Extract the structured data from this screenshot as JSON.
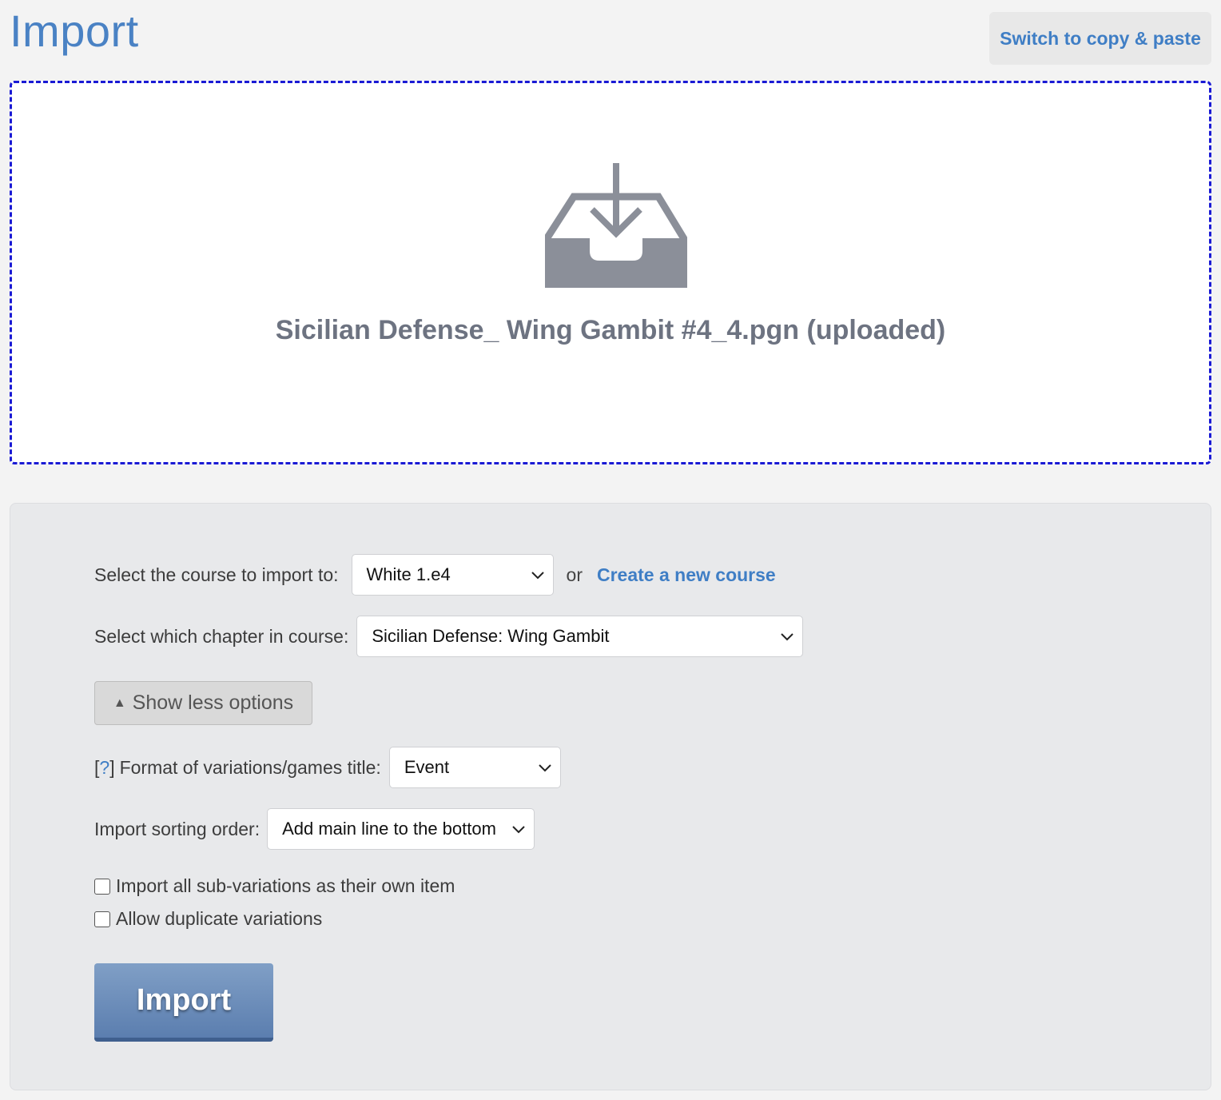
{
  "header": {
    "title": "Import",
    "switch_label": "Switch to copy & paste"
  },
  "dropzone": {
    "icon": "inbox-download-icon",
    "filename": "Sicilian Defense_ Wing Gambit #4_4.pgn (uploaded)"
  },
  "options": {
    "course": {
      "label": "Select the course to import to:",
      "selected": "White 1.e4",
      "or_text": "or",
      "create_link": "Create a new course"
    },
    "chapter": {
      "label": "Select which chapter in course:",
      "selected": "Sicilian Defense: Wing Gambit"
    },
    "toggle_label": "Show less options",
    "title_format": {
      "help_open": "[",
      "help_q": "?",
      "help_close": "]",
      "label": "Format of variations/games title:",
      "selected": "Event"
    },
    "sort_order": {
      "label": "Import sorting order:",
      "selected": "Add main line to the bottom"
    },
    "checkboxes": [
      {
        "label": "Import all sub-variations as their own item",
        "checked": false
      },
      {
        "label": "Allow duplicate variations",
        "checked": false
      }
    ],
    "import_label": "Import"
  },
  "colors": {
    "accent": "#3f7ec5",
    "dropzone_border": "#1a1ad4",
    "import_button": "#6a8cba"
  }
}
